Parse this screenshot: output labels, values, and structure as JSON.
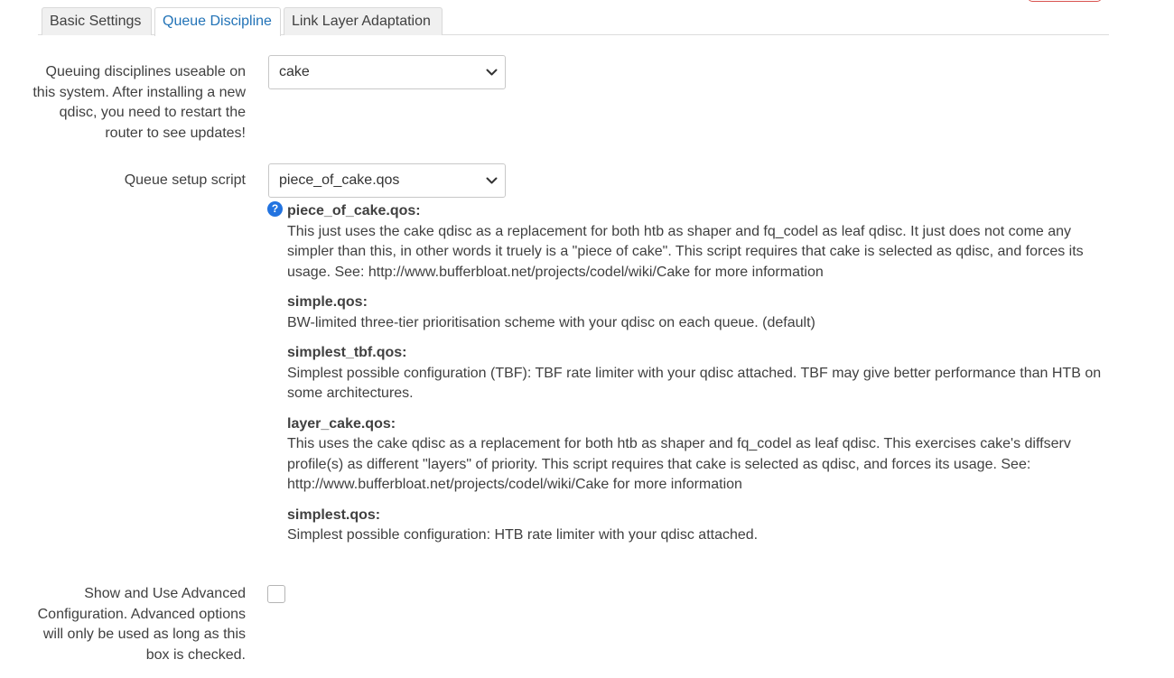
{
  "tabs": [
    {
      "label": "Basic Settings",
      "active": false
    },
    {
      "label": "Queue Discipline",
      "active": true
    },
    {
      "label": "Link Layer Adaptation",
      "active": false
    }
  ],
  "qdisc": {
    "label": "Queuing disciplines useable on this system. After installing a new qdisc, you need to restart the router to see updates!",
    "selected": "cake"
  },
  "script": {
    "label": "Queue setup script",
    "selected": "piece_of_cake.qos",
    "help_icon": "question-circle-icon",
    "descriptions": [
      {
        "name": "piece_of_cake.qos:",
        "text": "This just uses the cake qdisc as a replacement for both htb as shaper and fq_codel as leaf qdisc. It just does not come any simpler than this, in other words it truely is a \"piece of cake\". This script requires that cake is selected as qdisc, and forces its usage. See: http://www.bufferbloat.net/projects/codel/wiki/Cake for more information"
      },
      {
        "name": "simple.qos:",
        "text": "BW-limited three-tier prioritisation scheme with your qdisc on each queue. (default)"
      },
      {
        "name": "simplest_tbf.qos:",
        "text": "Simplest possible configuration (TBF): TBF rate limiter with your qdisc attached. TBF may give better performance than HTB on some architectures."
      },
      {
        "name": "layer_cake.qos:",
        "text": "This uses the cake qdisc as a replacement for both htb as shaper and fq_codel as leaf qdisc. This exercises cake's diffserv profile(s) as different \"layers\" of priority. This script requires that cake is selected as qdisc, and forces its usage. See: http://www.bufferbloat.net/projects/codel/wiki/Cake for more information"
      },
      {
        "name": "simplest.qos:",
        "text": "Simplest possible configuration: HTB rate limiter with your qdisc attached."
      }
    ]
  },
  "advanced": {
    "label": "Show and Use Advanced Configuration. Advanced options will only be used as long as this box is checked.",
    "checked": false
  },
  "colors": {
    "accent": "#2273b7",
    "help_icon": "#2273e0",
    "danger_button_border": "#d9534f",
    "text": "#404040"
  }
}
